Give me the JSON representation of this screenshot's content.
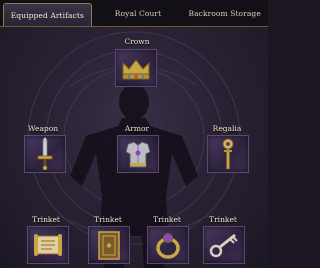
{
  "tabs": [
    {
      "label": "Equipped Artifacts",
      "active": true
    },
    {
      "label": "Royal Court",
      "active": false
    },
    {
      "label": "Backroom Storage",
      "active": false
    }
  ],
  "slots": {
    "crown": {
      "label": "Crown",
      "icon": "gold-crown-icon"
    },
    "weapon": {
      "label": "Weapon",
      "icon": "dagger-icon"
    },
    "armor": {
      "label": "Armor",
      "icon": "chestplate-icon"
    },
    "regalia": {
      "label": "Regalia",
      "icon": "scepter-icon"
    },
    "trinkets": [
      {
        "label": "Trinket",
        "icon": "scroll-icon"
      },
      {
        "label": "Trinket",
        "icon": "tome-icon"
      },
      {
        "label": "Trinket",
        "icon": "ring-icon"
      },
      {
        "label": "Trinket",
        "icon": "key-icon"
      }
    ]
  },
  "colors": {
    "gold": "#c9a646",
    "slot_bg": "#3b2e4f",
    "tab_bg": "#120f17"
  }
}
